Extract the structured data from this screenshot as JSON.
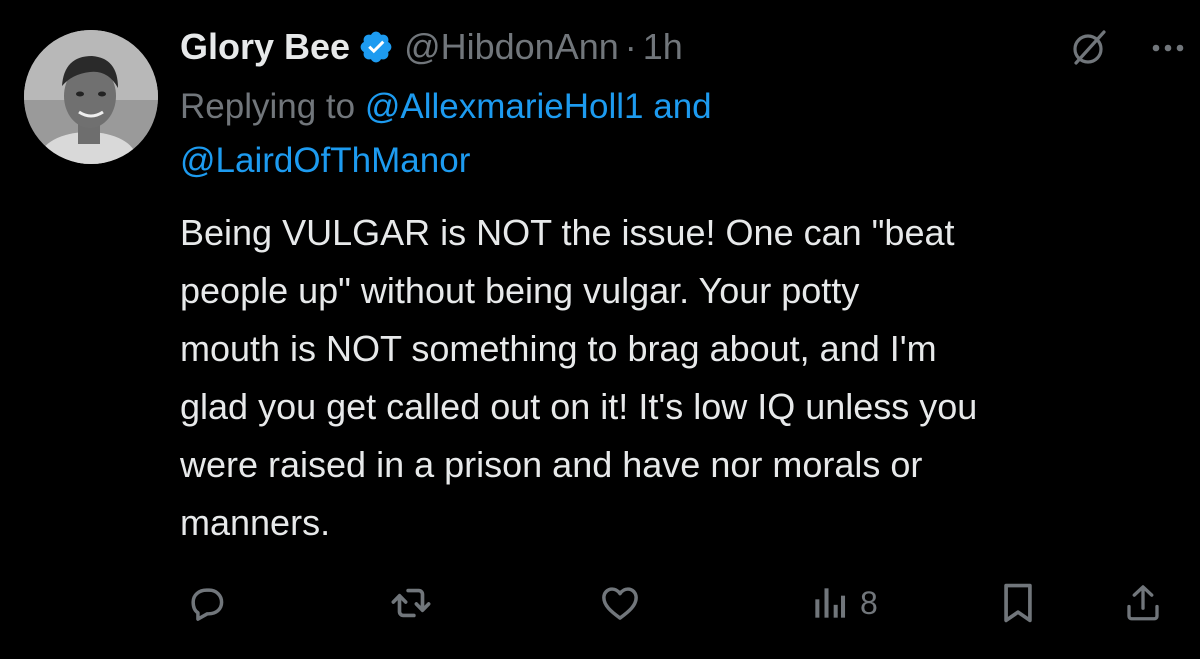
{
  "tweet": {
    "author_name": "Glory Bee",
    "handle": "@HibdonAnn",
    "separator": "·",
    "time": "1h",
    "replying_prefix": "Replying to ",
    "reply_mention_1": "@AllexmarieHoll1",
    "reply_conjunction": " and",
    "reply_mention_2": "@LairdOfThManor",
    "text": "Being VULGAR is NOT the issue!  One can \"beat\npeople up\" without being vulgar.  Your potty\nmouth is NOT something to brag about, and I'm\nglad you get called out on it!  It's low IQ unless you\nwere raised in a prison and have nor morals or\nmanners."
  },
  "actions": {
    "views_count": "8"
  },
  "icons": {
    "verified": "verified-badge-icon",
    "grok": "grok-icon",
    "more": "more-icon",
    "reply": "reply-icon",
    "retweet": "retweet-icon",
    "like": "like-icon",
    "views": "views-icon",
    "bookmark": "bookmark-icon",
    "share": "share-icon"
  },
  "colors": {
    "background": "#000000",
    "text_primary": "#e7e9ea",
    "text_secondary": "#71767b",
    "accent": "#1d9bf0"
  }
}
